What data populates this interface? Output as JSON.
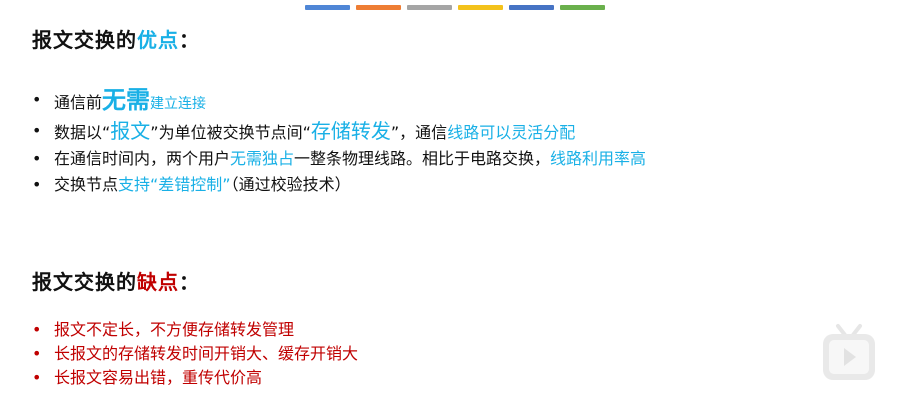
{
  "top_bar_colors": [
    "#4f86d6",
    "#ee7d34",
    "#a5a5a5",
    "#f3c21b",
    "#4673c4",
    "#6ab04c"
  ],
  "advantages": {
    "title_prefix": "报文交换的",
    "title_accent": "优点",
    "title_suffix": "：",
    "accent_color": "#19b0e6",
    "items": [
      {
        "parts": [
          {
            "text": "通信前",
            "style": "plain"
          },
          {
            "text": "无需",
            "style": "hl-big"
          },
          {
            "text": "建立连接",
            "style": "hl-small"
          }
        ]
      },
      {
        "parts": [
          {
            "text": "数据以“",
            "style": "plain"
          },
          {
            "text": "报文",
            "style": "hl-med"
          },
          {
            "text": "”为单位被交换节点间“",
            "style": "plain"
          },
          {
            "text": "存储转发",
            "style": "hl-med"
          },
          {
            "text": "”，通信",
            "style": "plain"
          },
          {
            "text": "线路可以灵活分配",
            "style": "hl"
          }
        ]
      },
      {
        "parts": [
          {
            "text": "在通信时间内，两个用户",
            "style": "plain"
          },
          {
            "text": "无需独占",
            "style": "hl"
          },
          {
            "text": "一整条物理线路。相比于电路交换，",
            "style": "plain"
          },
          {
            "text": "线路利用率高",
            "style": "hl"
          }
        ]
      },
      {
        "parts": [
          {
            "text": "交换节点",
            "style": "plain"
          },
          {
            "text": "支持“差错控制”",
            "style": "hl"
          },
          {
            "text": "（通过校验技术）",
            "style": "plain"
          }
        ]
      }
    ]
  },
  "disadvantages": {
    "title_prefix": "报文交换的",
    "title_accent": "缺点",
    "title_suffix": "：",
    "accent_color": "#c00000",
    "items": [
      "报文不定长，不方便存储转发管理",
      "长报文的存储转发时间开销大、缓存开销大",
      "长报文容易出错，重传代价高"
    ]
  },
  "bullet_symbol": "•"
}
